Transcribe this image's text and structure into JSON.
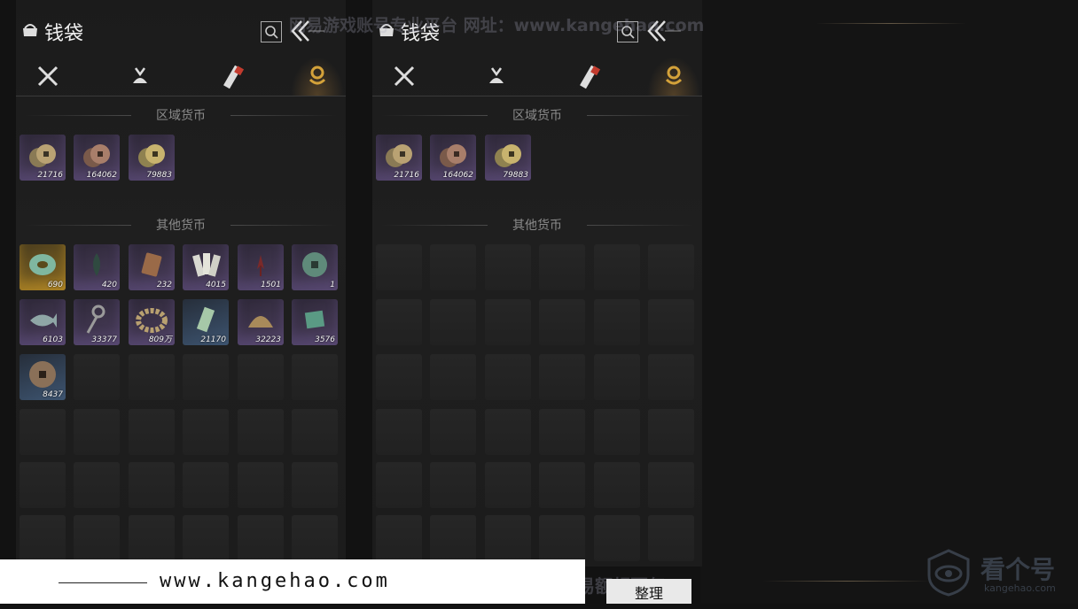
{
  "wallet": {
    "title": "钱袋",
    "section_region": "区域货币",
    "section_other": "其他货币",
    "tabs": [
      "weapon-tab",
      "pouch-tab",
      "scroll-tab",
      "currency-tab"
    ],
    "region_items": [
      {
        "count": "21716",
        "icon": "copper-coin-pile",
        "quality": "purple"
      },
      {
        "count": "164062",
        "icon": "reddish-coin-pile",
        "quality": "purple"
      },
      {
        "count": "79883",
        "icon": "gold-coin-pile",
        "quality": "purple"
      }
    ],
    "other_items": [
      {
        "count": "690",
        "icon": "jade-ring",
        "quality": "gold"
      },
      {
        "count": "420",
        "icon": "dark-feather",
        "quality": "purple"
      },
      {
        "count": "232",
        "icon": "bronze-plate",
        "quality": "purple"
      },
      {
        "count": "4015",
        "icon": "paper-notes",
        "quality": "purple"
      },
      {
        "count": "1501",
        "icon": "red-ribbon",
        "quality": "purple"
      },
      {
        "count": "1",
        "icon": "jade-coin",
        "quality": "purple"
      },
      {
        "count": "6103",
        "icon": "fish-token",
        "quality": "purple"
      },
      {
        "count": "33377",
        "icon": "coin-string",
        "quality": "purple"
      },
      {
        "count": "809万",
        "icon": "coin-ring",
        "quality": "purple"
      },
      {
        "count": "21170",
        "icon": "jade-stack",
        "quality": "blue"
      },
      {
        "count": "32223",
        "icon": "half-disc",
        "quality": "purple"
      },
      {
        "count": "3576",
        "icon": "green-cloth",
        "quality": "purple"
      },
      {
        "count": "8437",
        "icon": "square-hole-coin",
        "quality": "blue"
      }
    ]
  },
  "watermarks": {
    "top": "网易游戏账号专业平台 网址：www.kangehao.com",
    "bottom": "看个号专业网易游戏八年 年交易额超百亿",
    "logo_text": "看个号",
    "logo_sub": "kangehao.com"
  },
  "footer": {
    "url": "www.kangehao.com",
    "sort_button": "整理"
  },
  "colors": {
    "accent_gold": "#d4a23a",
    "panel_bg": "#1d1d1d",
    "purple_quality": "#4c3f5e",
    "gold_quality": "#8a6a22",
    "blue_quality": "#3d5470"
  }
}
